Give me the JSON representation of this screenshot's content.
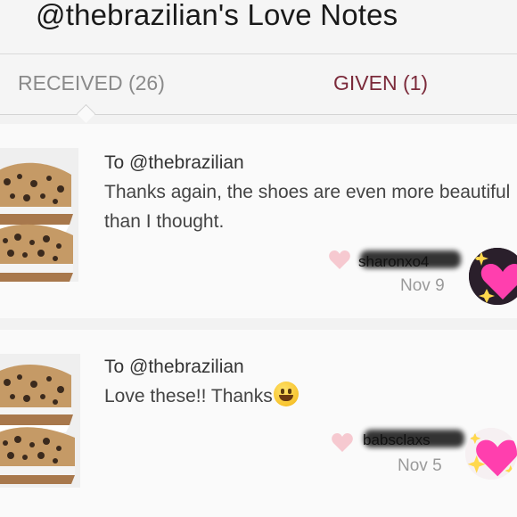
{
  "header": {
    "title": "@thebrazilian's Love Notes"
  },
  "tabs": [
    {
      "label": "RECEIVED (26)",
      "active": true
    },
    {
      "label": "GIVEN (1)",
      "active": false
    }
  ],
  "notes": [
    {
      "to": "To @thebrazilian",
      "message": "Thanks again, the shoes are even more beautiful than I thought.",
      "username": "sharonxo4",
      "date": "Nov 9",
      "icons": [
        "shoe-thumbnail",
        "heart-icon",
        "sparkling-heart-avatar"
      ]
    },
    {
      "to": "To @thebrazilian",
      "message": "Love these!! Thanks",
      "username": "babsclaxs",
      "date": "Nov 5",
      "icons": [
        "shoe-thumbnail",
        "grinning-emoji-icon",
        "heart-icon",
        "sparkling-heart-avatar"
      ]
    }
  ],
  "colors": {
    "background": "#f2f2f2",
    "card": "#fafafa",
    "given_tab": "#7b2a3a",
    "received_tab": "#8a8a8a",
    "heart": "#f6c9d0",
    "avatar_heart": "#ff3fae"
  }
}
